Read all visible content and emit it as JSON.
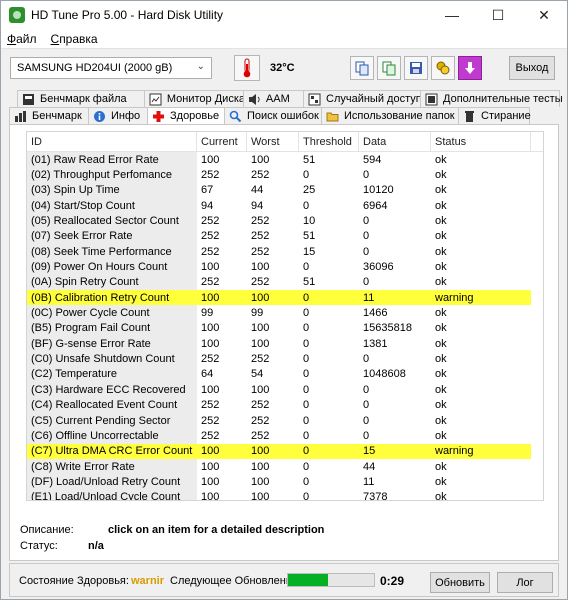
{
  "window": {
    "title": "HD Tune Pro 5.00 - Hard Disk Utility"
  },
  "menu": [
    "Файл",
    "Справка"
  ],
  "toolbar": {
    "drive": "SAMSUNG HD204UI (2000 gB)",
    "temperature": "32°C",
    "exit_label": "Выход"
  },
  "tabs_row1": [
    {
      "label": "Бенчмарк файла",
      "icon": "file-benchmark-icon"
    },
    {
      "label": "Монитор Диска",
      "icon": "disk-monitor-icon"
    },
    {
      "label": "AAM",
      "icon": "speaker-icon"
    },
    {
      "label": "Случайный доступ",
      "icon": "random-access-icon"
    },
    {
      "label": "Дополнительные тесты",
      "icon": "extra-tests-icon"
    }
  ],
  "tabs_row2": [
    {
      "label": "Бенчмарк",
      "icon": "benchmark-icon"
    },
    {
      "label": "Инфо",
      "icon": "info-icon"
    },
    {
      "label": "Здоровье",
      "icon": "health-cross-icon",
      "active": true
    },
    {
      "label": "Поиск ошибок",
      "icon": "error-scan-icon"
    },
    {
      "label": "Использование папок",
      "icon": "folder-usage-icon"
    },
    {
      "label": "Стирание",
      "icon": "erase-icon"
    }
  ],
  "columns": [
    "ID",
    "Current",
    "Worst",
    "Threshold",
    "Data",
    "Status"
  ],
  "rows": [
    [
      "(01) Raw Read Error Rate",
      "100",
      "100",
      "51",
      "594",
      "ok"
    ],
    [
      "(02) Throughput Perfomance",
      "252",
      "252",
      "0",
      "0",
      "ok"
    ],
    [
      "(03) Spin Up Time",
      "67",
      "44",
      "25",
      "10120",
      "ok"
    ],
    [
      "(04) Start/Stop Count",
      "94",
      "94",
      "0",
      "6964",
      "ok"
    ],
    [
      "(05) Reallocated Sector Count",
      "252",
      "252",
      "10",
      "0",
      "ok"
    ],
    [
      "(07) Seek Error Rate",
      "252",
      "252",
      "51",
      "0",
      "ok"
    ],
    [
      "(08) Seek Time Performance",
      "252",
      "252",
      "15",
      "0",
      "ok"
    ],
    [
      "(09) Power On Hours Count",
      "100",
      "100",
      "0",
      "36096",
      "ok"
    ],
    [
      "(0A) Spin Retry Count",
      "252",
      "252",
      "51",
      "0",
      "ok"
    ],
    [
      "(0B) Calibration Retry Count",
      "100",
      "100",
      "0",
      "11",
      "warning"
    ],
    [
      "(0C) Power Cycle Count",
      "99",
      "99",
      "0",
      "1466",
      "ok"
    ],
    [
      "(B5) Program Fail Count",
      "100",
      "100",
      "0",
      "15635818",
      "ok"
    ],
    [
      "(BF) G-sense Error Rate",
      "100",
      "100",
      "0",
      "1381",
      "ok"
    ],
    [
      "(C0) Unsafe Shutdown Count",
      "252",
      "252",
      "0",
      "0",
      "ok"
    ],
    [
      "(C2) Temperature",
      "64",
      "54",
      "0",
      "1048608",
      "ok"
    ],
    [
      "(C3) Hardware ECC Recovered",
      "100",
      "100",
      "0",
      "0",
      "ok"
    ],
    [
      "(C4) Reallocated Event Count",
      "252",
      "252",
      "0",
      "0",
      "ok"
    ],
    [
      "(C5) Current Pending Sector",
      "252",
      "252",
      "0",
      "0",
      "ok"
    ],
    [
      "(C6) Offline Uncorrectable",
      "252",
      "252",
      "0",
      "0",
      "ok"
    ],
    [
      "(C7) Ultra DMA CRC Error Count",
      "100",
      "100",
      "0",
      "15",
      "warning"
    ],
    [
      "(C8) Write Error Rate",
      "100",
      "100",
      "0",
      "44",
      "ok"
    ],
    [
      "(DF) Load/Unload Retry Count",
      "100",
      "100",
      "0",
      "11",
      "ok"
    ],
    [
      "(E1) Load/Unload Cycle Count",
      "100",
      "100",
      "0",
      "7378",
      "ok"
    ]
  ],
  "info": {
    "description_label": "Описание:",
    "description_value": "click on an item for a detailed description",
    "status_label": "Статус:",
    "status_value": "n/a"
  },
  "footer": {
    "health_label": "Состояние Здоровья:",
    "health_value": "warnir",
    "next_update_label": "Следующее Обновление:",
    "progress": 0.47,
    "timer": "0:29",
    "update_button": "Обновить",
    "log_button": "Лог"
  },
  "colors": {
    "warning_row": "#ffff3b",
    "progress": "#06b025",
    "health_warning": "#d89b00"
  }
}
